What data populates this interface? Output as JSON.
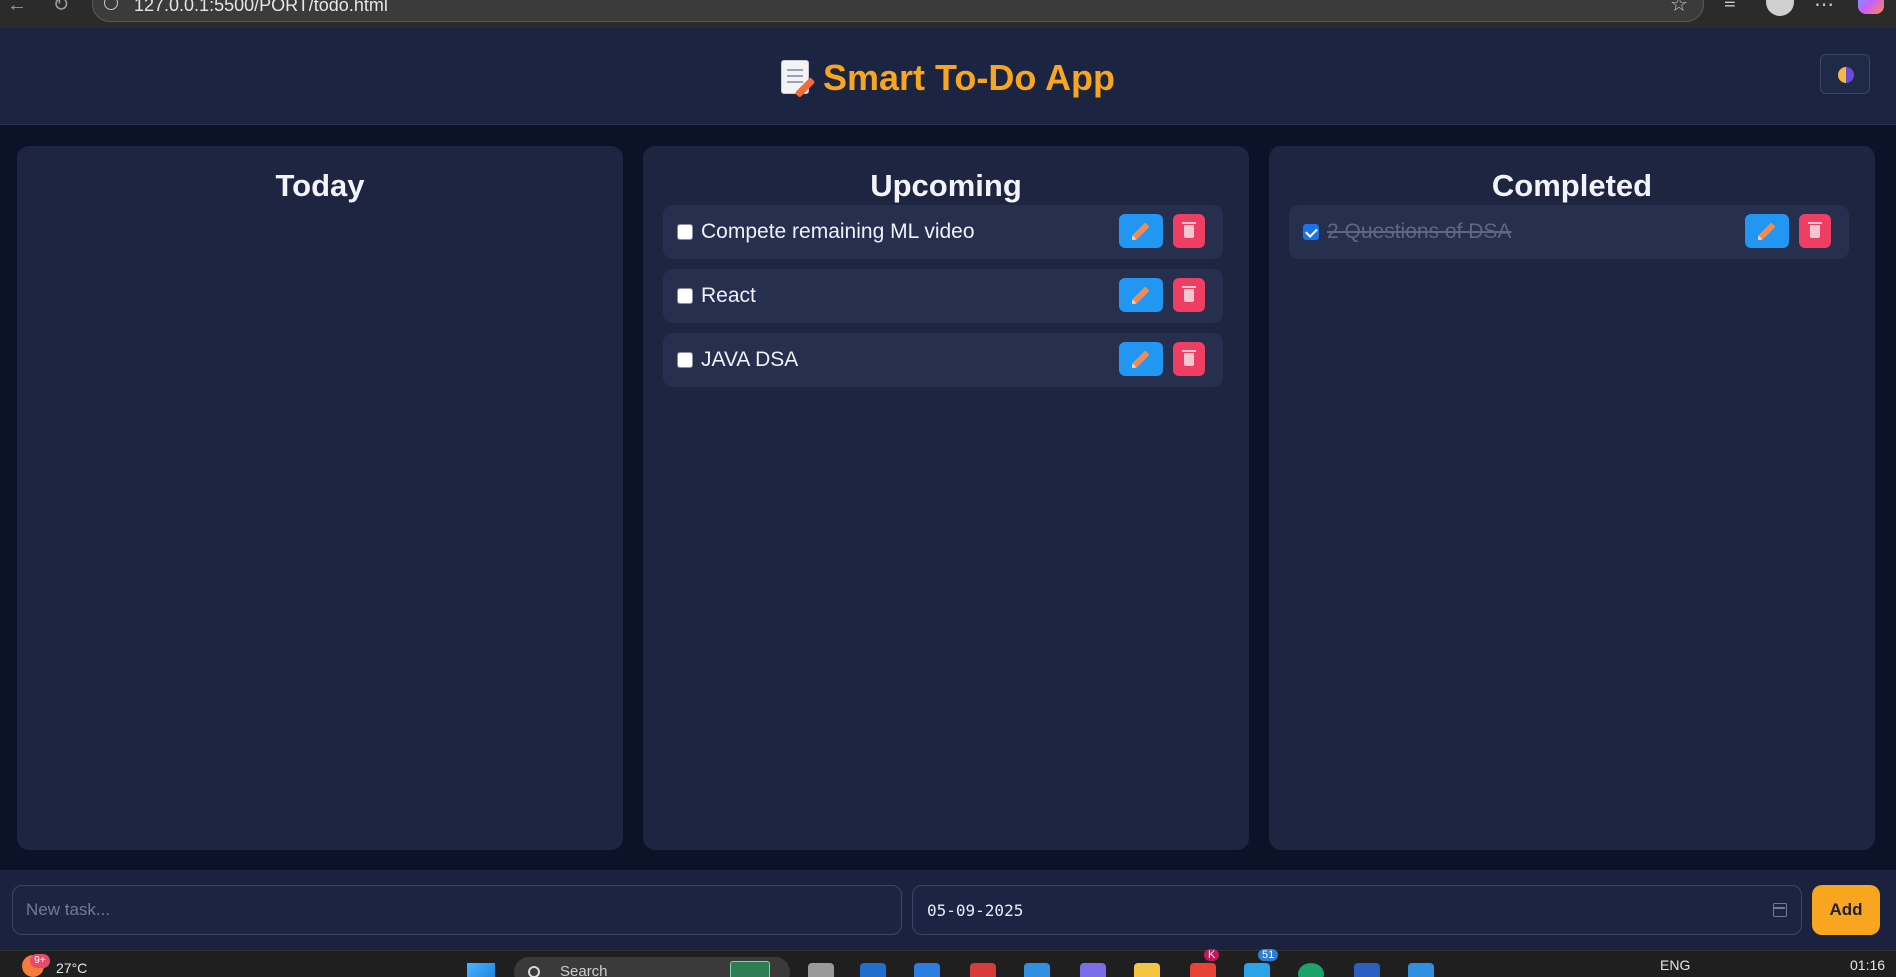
{
  "browser": {
    "url": "127.0.0.1:5500/PORT/todo.html",
    "icons": [
      "back-icon",
      "reload-icon",
      "site-info-icon",
      "star-icon",
      "favorites-icon",
      "profile-icon",
      "more-icon",
      "copilot-icon"
    ]
  },
  "header": {
    "title": "Smart To-Do App",
    "title_icon": "memo-icon",
    "theme_toggle_icon": "theme-toggle-icon"
  },
  "columns": {
    "today": {
      "title": "Today",
      "tasks": []
    },
    "upcoming": {
      "title": "Upcoming",
      "tasks": [
        {
          "text": "Compete remaining ML video",
          "done": false
        },
        {
          "text": "React",
          "done": false
        },
        {
          "text": "JAVA DSA",
          "done": false
        }
      ]
    },
    "completed": {
      "title": "Completed",
      "tasks": [
        {
          "text": "2 Questions of DSA",
          "done": true
        }
      ]
    }
  },
  "input_bar": {
    "task_placeholder": "New task...",
    "task_value": "",
    "date_value": "05-09-2025",
    "add_label": "Add"
  },
  "taskbar": {
    "weather_badge": "9+",
    "temperature": "27°C",
    "search_label": "Search",
    "lang": "ENG",
    "time": "01:16",
    "badge_k": "K",
    "badge_51": "51"
  },
  "colors": {
    "accent": "#f8a620",
    "edit": "#2196f3",
    "delete": "#ee3e64",
    "panel": "#1d2541",
    "background": "#0c1328"
  }
}
